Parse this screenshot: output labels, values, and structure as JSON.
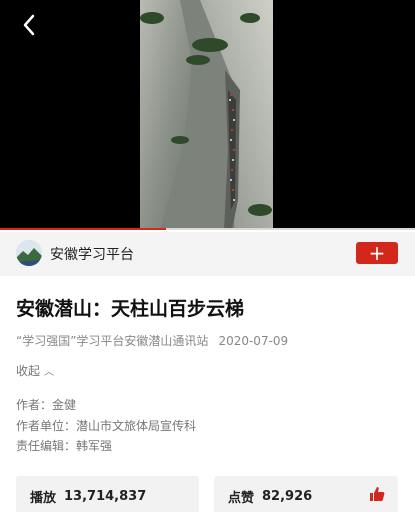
{
  "colors": {
    "accent": "#d2281c",
    "video_bg": "#000000",
    "account_bar_bg": "#f4f4f4"
  },
  "video": {
    "progress_fraction": 0.4,
    "back_icon": "chevron-left-icon"
  },
  "account": {
    "name": "安徽学习平台",
    "follow_icon": "plus-icon",
    "follow_label": "+"
  },
  "article": {
    "title": "安徽潜山：天柱山百步云梯",
    "source": "“学习强国”学习平台安徽潜山通讯站",
    "date": "2020-07-09",
    "collapse_label": "收起",
    "author": "作者：金健",
    "author_unit": "作者单位：潜山市文旅体局宣传科",
    "editor": "责任编辑：韩军强"
  },
  "stats": {
    "views_label": "播放",
    "views_value": "13,714,837",
    "likes_label": "点赞",
    "likes_value": "82,926",
    "like_icon": "thumbs-up-icon"
  }
}
